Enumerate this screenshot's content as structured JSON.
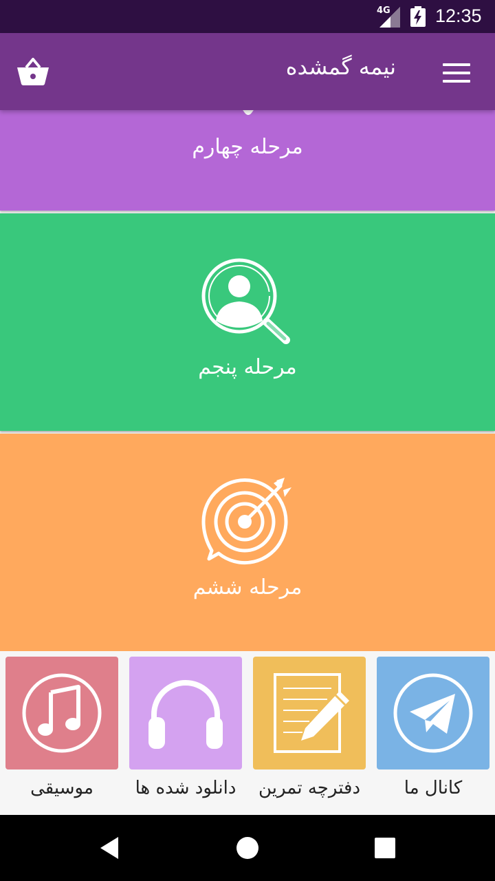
{
  "status_bar": {
    "network": "4G",
    "time": "12:35"
  },
  "app_bar": {
    "title": "نیمه گمشده",
    "menu_icon": "hamburger-menu-icon",
    "cart_icon": "shopping-basket-icon"
  },
  "stages": [
    {
      "label": "مرحله چهارم",
      "color": "#b467d6"
    },
    {
      "label": "مرحله پنجم",
      "color": "#39c87c",
      "icon": "person-search-icon"
    },
    {
      "label": "مرحله ششم",
      "color": "#ffa95d",
      "icon": "target-arrow-icon"
    }
  ],
  "bottom_menu": [
    {
      "label": "موسیقی",
      "color": "#df7f8b",
      "icon": "music-note-icon"
    },
    {
      "label": "دانلود شده ها",
      "color": "#d4a2f0",
      "icon": "headphones-icon"
    },
    {
      "label": "دفترچه تمرین",
      "color": "#f0be5a",
      "icon": "notebook-pencil-icon"
    },
    {
      "label": "کانال ما",
      "color": "#7ab3e5",
      "icon": "telegram-icon"
    }
  ],
  "nav_bar": {
    "back_icon": "back-triangle-icon",
    "home_icon": "home-circle-icon",
    "recents_icon": "recents-square-icon"
  }
}
